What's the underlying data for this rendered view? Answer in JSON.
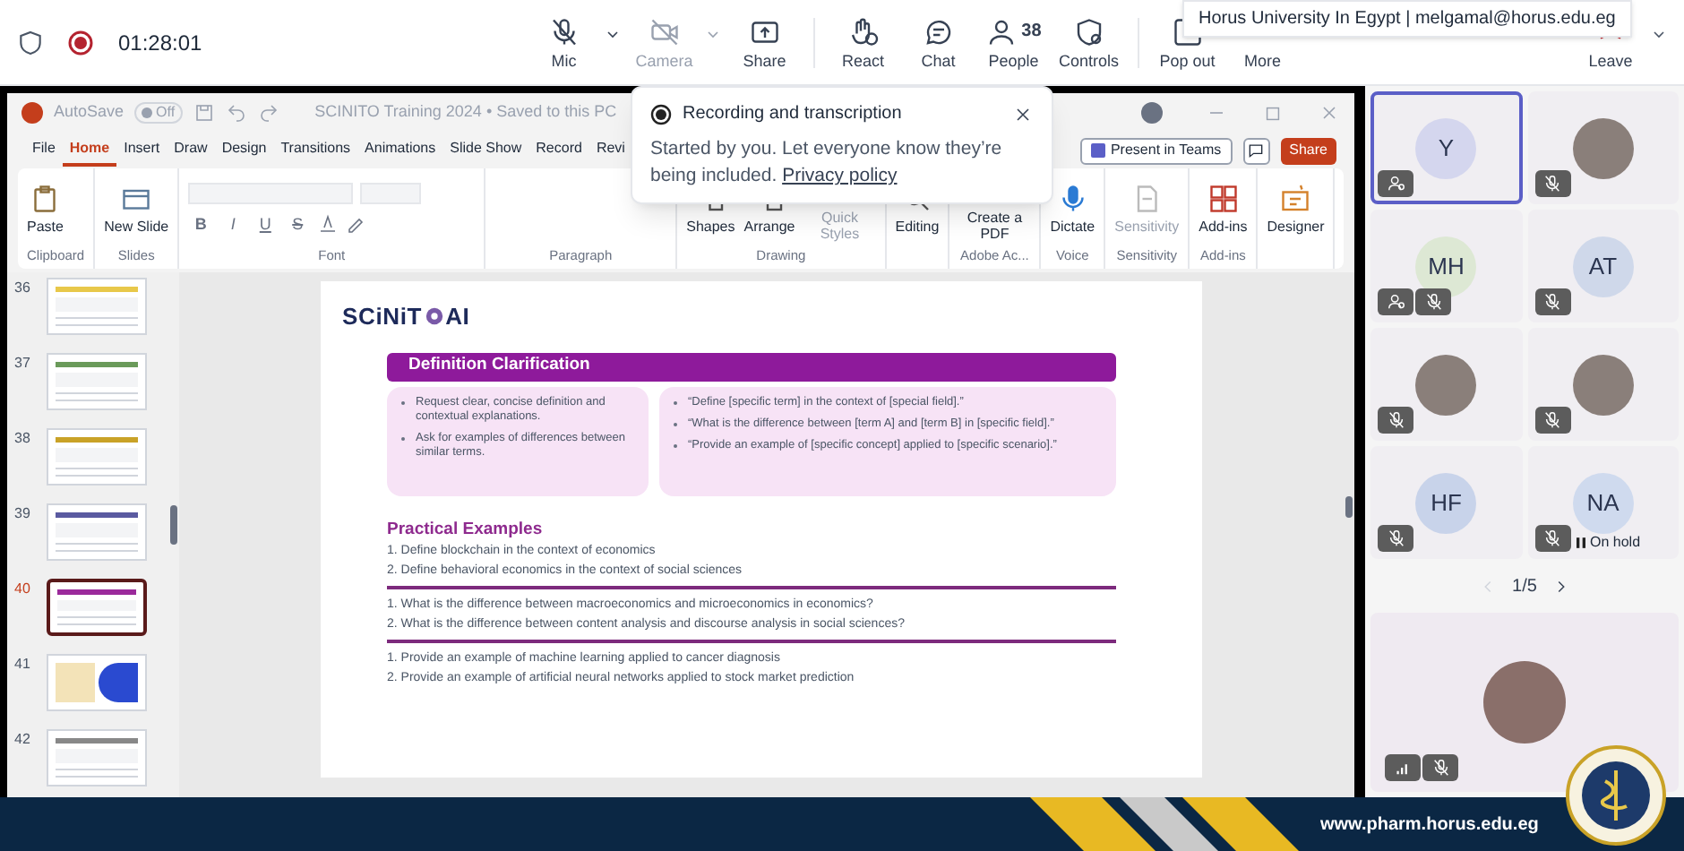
{
  "meeting_bar": {
    "recording": true,
    "timer": "01:28:01",
    "control_groups": [
      [
        {
          "label": "Mic",
          "kind": "mic",
          "disabled": false,
          "menu": true
        },
        {
          "label": "Camera",
          "kind": "camera",
          "disabled": true,
          "menu": true
        },
        {
          "label": "Share",
          "kind": "share",
          "disabled": false,
          "menu": false
        }
      ],
      [
        {
          "label": "React",
          "kind": "react",
          "disabled": false,
          "menu": false
        },
        {
          "label": "Chat",
          "kind": "chat",
          "disabled": false,
          "menu": false
        },
        {
          "label": "People",
          "kind": "people",
          "disabled": false,
          "menu": false,
          "count": "38"
        },
        {
          "label": "Controls",
          "kind": "controls",
          "disabled": false,
          "menu": false
        }
      ],
      [
        {
          "label": "Pop out",
          "kind": "popout",
          "disabled": false,
          "menu": false
        },
        {
          "label": "More",
          "kind": "more",
          "disabled": false,
          "menu": false
        }
      ]
    ],
    "leave": {
      "label": "Leave"
    },
    "account_tooltip": "Horus University In Egypt | melgamal@horus.edu.eg"
  },
  "powerpoint": {
    "autosave_label": "AutoSave",
    "autosave_state": "Off",
    "title": "SCINITO Training 2024 • Saved to this PC",
    "tabs": [
      {
        "label": "File",
        "selected": false
      },
      {
        "label": "Home",
        "selected": true
      },
      {
        "label": "Insert",
        "selected": false
      },
      {
        "label": "Draw",
        "selected": false
      },
      {
        "label": "Design",
        "selected": false
      },
      {
        "label": "Transitions",
        "selected": false
      },
      {
        "label": "Animations",
        "selected": false
      },
      {
        "label": "Slide Show",
        "selected": false
      },
      {
        "label": "Record",
        "selected": false
      },
      {
        "label": "Revi",
        "selected": false
      }
    ],
    "present_button": "Present in Teams",
    "share_button": "Share",
    "ribbon_groups": [
      {
        "kind": "buttons",
        "name": "Clipboard",
        "buttons": [
          {
            "label": "Paste",
            "kind": "paste",
            "disabled": false
          }
        ]
      },
      {
        "kind": "buttons",
        "name": "Slides",
        "buttons": [
          {
            "label": "New Slide",
            "kind": "newslide",
            "disabled": false
          }
        ]
      },
      {
        "kind": "font",
        "name": "Font",
        "format_buttons": [
          "B",
          "I",
          "U",
          "S"
        ]
      },
      {
        "kind": "paragraph",
        "name": "Paragraph"
      },
      {
        "kind": "buttons",
        "name": "Drawing",
        "buttons": [
          {
            "label": "Shapes",
            "kind": "shapes",
            "disabled": false
          },
          {
            "label": "Arrange",
            "kind": "arrange",
            "disabled": false
          },
          {
            "label": "Quick Styles",
            "kind": "styles",
            "disabled": true
          }
        ]
      },
      {
        "kind": "buttons",
        "buttons": [
          {
            "label": "Editing",
            "kind": "editing",
            "disabled": false
          }
        ]
      },
      {
        "kind": "buttons",
        "name": "Adobe Ac...",
        "buttons": [
          {
            "label": "Create a PDF",
            "kind": "pdf",
            "disabled": false
          }
        ]
      },
      {
        "kind": "buttons",
        "name": "Voice",
        "buttons": [
          {
            "label": "Dictate",
            "kind": "dictate",
            "disabled": false
          }
        ]
      },
      {
        "kind": "buttons",
        "name": "Sensitivity",
        "buttons": [
          {
            "label": "Sensitivity",
            "kind": "sensitivity",
            "disabled": true
          }
        ]
      },
      {
        "kind": "buttons",
        "name": "Add-ins",
        "buttons": [
          {
            "label": "Add-ins",
            "kind": "addins",
            "disabled": false
          }
        ]
      },
      {
        "kind": "buttons",
        "buttons": [
          {
            "label": "Designer",
            "kind": "designer",
            "disabled": false
          }
        ]
      }
    ],
    "thumbnails": [
      {
        "number": "36",
        "selected": false,
        "kind": "table",
        "color": "#e8c84a"
      },
      {
        "number": "37",
        "selected": false,
        "kind": "table",
        "color": "#6a9a5a"
      },
      {
        "number": "38",
        "selected": false,
        "kind": "table",
        "color": "#c9a227"
      },
      {
        "number": "39",
        "selected": false,
        "kind": "table",
        "color": "#5a5aa0"
      },
      {
        "number": "40",
        "selected": true,
        "kind": "table",
        "color": "#9b2a9b"
      },
      {
        "number": "41",
        "selected": false,
        "kind": "image",
        "color": "#2a4ad0"
      },
      {
        "number": "42",
        "selected": false,
        "kind": "table",
        "color": "#888888"
      }
    ],
    "slide": {
      "logo_parts": [
        "SCiNiT",
        "AI"
      ],
      "heading": "Definition Clarification",
      "left_bullets": [
        "Request clear, concise definition and contextual explanations.",
        "Ask for examples of differences between similar terms."
      ],
      "right_bullets": [
        "“Define [specific term] in the context of [special field].”",
        "“What is the difference between [term A] and [term B] in [specific field].”",
        "“Provide an example of [specific concept] applied to [specific scenario].”"
      ],
      "section_title": "Practical Examples",
      "example_groups": [
        [
          "1. Define blockchain in the context of economics",
          "2. Define behavioral economics in the context of social sciences"
        ],
        [
          "1. What is the difference between macroeconomics and microeconomics in economics?",
          "2. What is the difference between content analysis and discourse analysis in social sciences?"
        ],
        [
          "1. Provide an example of machine learning applied to cancer diagnosis",
          "2. Provide an example of artificial neural networks applied to stock market prediction"
        ]
      ]
    }
  },
  "recording_popup": {
    "title": "Recording and transcription",
    "message": "Started by you. Let everyone know they’re being included.",
    "link": "Privacy policy"
  },
  "participants": [
    {
      "kind": "initials",
      "initials": "Y",
      "color": "#d4d6ee",
      "selected": true,
      "role_badge": true,
      "muted": false
    },
    {
      "kind": "photo",
      "selected": false,
      "role_badge": false,
      "muted": true
    },
    {
      "kind": "initials",
      "initials": "MH",
      "color": "#dde8d4",
      "selected": false,
      "role_badge": true,
      "muted": true
    },
    {
      "kind": "initials",
      "initials": "AT",
      "color": "#cfd8ea",
      "selected": false,
      "role_badge": false,
      "muted": true
    },
    {
      "kind": "photo",
      "selected": false,
      "role_badge": false,
      "muted": true
    },
    {
      "kind": "photo",
      "selected": false,
      "role_badge": false,
      "muted": true
    },
    {
      "kind": "initials",
      "initials": "HF",
      "color": "#c8d3ea",
      "selected": false,
      "role_badge": false,
      "muted": true
    },
    {
      "kind": "initials",
      "initials": "NA",
      "color": "#cfdaee",
      "selected": false,
      "role_badge": false,
      "muted": true,
      "status": "On hold"
    }
  ],
  "pager": "1/5",
  "self_tile": {
    "muted": true
  },
  "banner": {
    "url": "www.pharm.horus.edu.eg"
  }
}
